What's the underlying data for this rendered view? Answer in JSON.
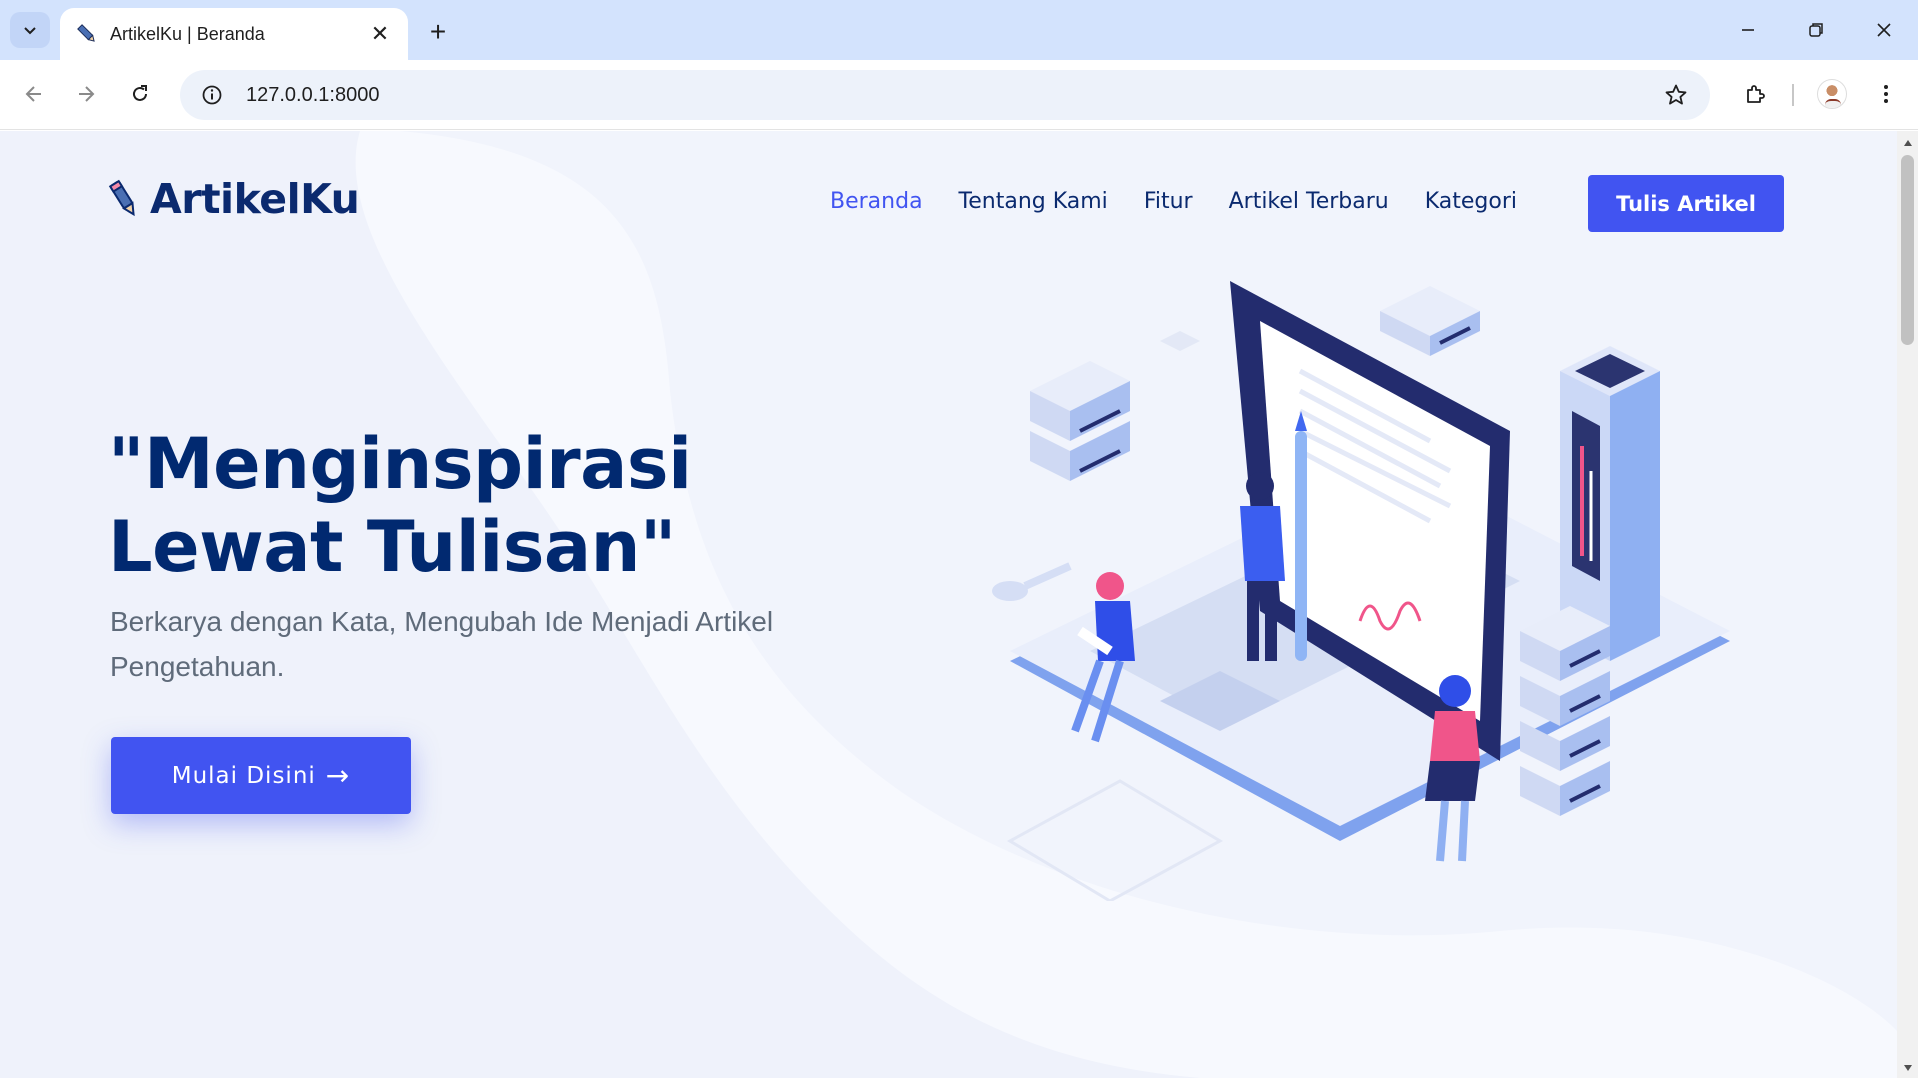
{
  "browser": {
    "tab_title": "ArtikelKu | Beranda",
    "tab_close": "✕",
    "new_tab": "+",
    "url": "127.0.0.1:8000"
  },
  "site": {
    "logo_text": "ArtikelKu",
    "nav": [
      {
        "label": "Beranda",
        "active": true
      },
      {
        "label": "Tentang Kami",
        "active": false
      },
      {
        "label": "Fitur",
        "active": false
      },
      {
        "label": "Artikel Terbaru",
        "active": false
      },
      {
        "label": "Kategori",
        "active": false
      }
    ],
    "cta_label": "Tulis Artikel"
  },
  "hero": {
    "title": "\"Menginspirasi Lewat Tulisan\"",
    "subtitle": "Berkarya dengan Kata, Mengubah Ide Menjadi Artikel Pengetahuan.",
    "button_label": "Mulai Disini",
    "button_arrow": "→"
  },
  "colors": {
    "accent": "#4154f1",
    "heading": "#012970",
    "tabstrip": "#d3e3fd"
  },
  "icons": [
    "chevron-down-icon",
    "pencil-icon",
    "close-icon",
    "plus-icon",
    "minimize-icon",
    "restore-icon",
    "back-icon",
    "forward-icon",
    "reload-icon",
    "info-icon",
    "star-icon",
    "extensions-icon",
    "menu-dots-icon"
  ]
}
